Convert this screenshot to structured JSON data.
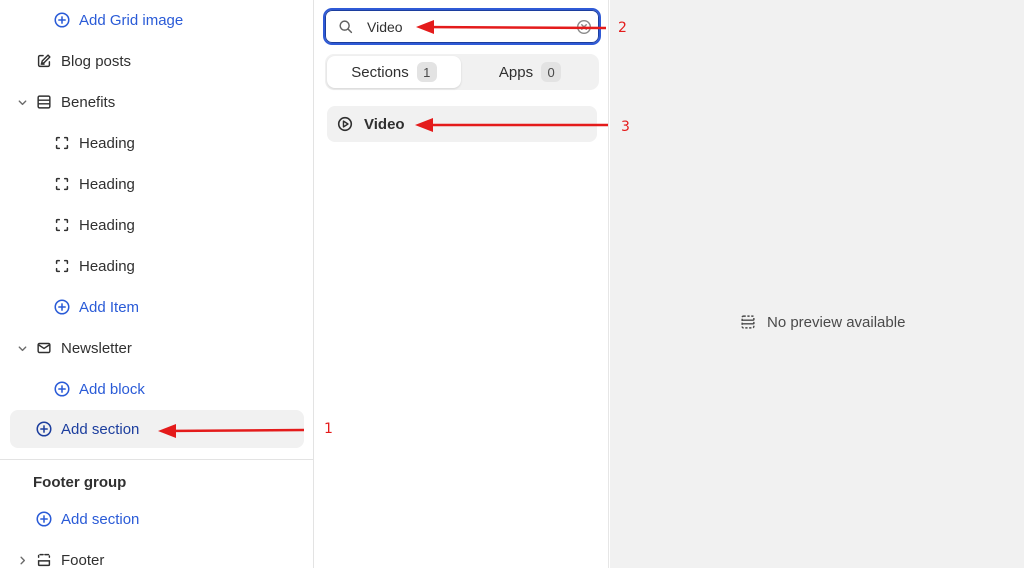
{
  "sidebar": {
    "items": [
      {
        "label": "Add Grid image"
      },
      {
        "label": "Blog posts"
      },
      {
        "label": "Benefits"
      },
      {
        "label": "Heading"
      },
      {
        "label": "Heading"
      },
      {
        "label": "Heading"
      },
      {
        "label": "Heading"
      },
      {
        "label": "Add Item"
      },
      {
        "label": "Newsletter"
      },
      {
        "label": "Add block"
      },
      {
        "label": "Add section"
      }
    ],
    "footer_group": {
      "title": "Footer group",
      "add_section": "Add section",
      "footer": "Footer"
    }
  },
  "picker": {
    "search": {
      "value": "Video",
      "placeholder": "Search"
    },
    "tabs": [
      {
        "label": "Sections",
        "count": "1"
      },
      {
        "label": "Apps",
        "count": "0"
      }
    ],
    "results": [
      {
        "label": "Video"
      }
    ]
  },
  "preview": {
    "empty_text": "No preview available"
  },
  "annotations": {
    "labels": [
      "1",
      "2",
      "3"
    ],
    "color": "#e41b1b"
  },
  "colors": {
    "accent": "#2a5bd7",
    "focus_border": "#2f5ad6",
    "preview_bg": "#f1f1f1"
  }
}
